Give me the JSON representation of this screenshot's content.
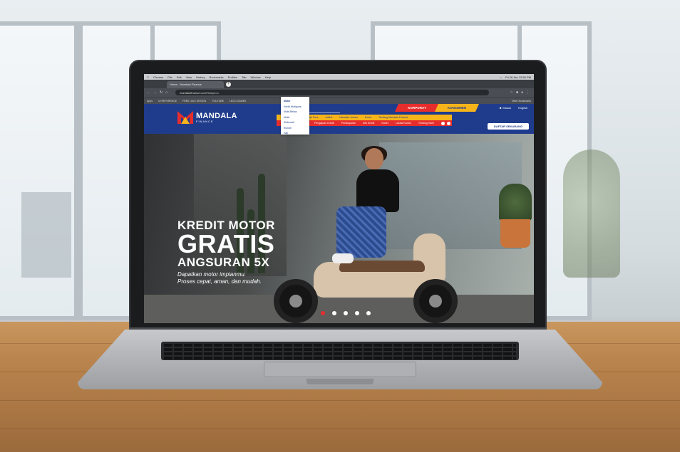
{
  "macbar": {
    "items": [
      "Chrome",
      "File",
      "Edit",
      "View",
      "History",
      "Bookmarks",
      "Profiles",
      "Tab",
      "Window",
      "Help"
    ],
    "clock": "Fri 26 Jan 12:56 PM"
  },
  "browser": {
    "tab_title": "Home - Mandala Finance",
    "url": "mandalafinance.com/?lcmpr=o",
    "bookmarks": [
      "Apps",
      "UI REFERENCE",
      "FREE UIUX DESIGN",
      "YOUTUBE",
      "LEGO GAMES"
    ],
    "bookmarks_right": "Other Bookmarks"
  },
  "site": {
    "logo_text": "MANDALA",
    "logo_sub": "FINANCE",
    "search_placeholder": "Cari disini...",
    "seg_korporat": "KORPORAT",
    "seg_konsumen": "KONSUMEN",
    "masuk": "Masuk",
    "english": "English",
    "menu1": [
      "Penghargaan",
      "Siaran Pers",
      "Artikel",
      "Mandala Jumbo",
      "Event",
      "Tentang Mandala Finance"
    ],
    "menu2": [
      "Produk",
      "Simulasi",
      "Pengajuan Kredit",
      "Pembayaran",
      "Info Kredit",
      "Karier",
      "Lokasi Kantor",
      "Tentang Kami"
    ],
    "cta": "DAFTAR SEKARANG",
    "dropdown": [
      "Motor",
      "Kredit Multiguna",
      "Mobil Bekas",
      "Mobil",
      "Elektronik",
      "Rumah",
      "Haji"
    ]
  },
  "hero": {
    "line1": "KREDIT MOTOR",
    "line2": "GRATIS",
    "line3": "ANGSURAN 5X",
    "tagline1": "Dapatkan motor impianmu.",
    "tagline2": "Proses cepat, aman, dan mudah.",
    "slides": 5,
    "active_slide": 1
  },
  "colors": {
    "brand_blue": "#1f3c8c",
    "brand_red": "#e62d2d",
    "brand_yellow": "#f6b41a"
  }
}
